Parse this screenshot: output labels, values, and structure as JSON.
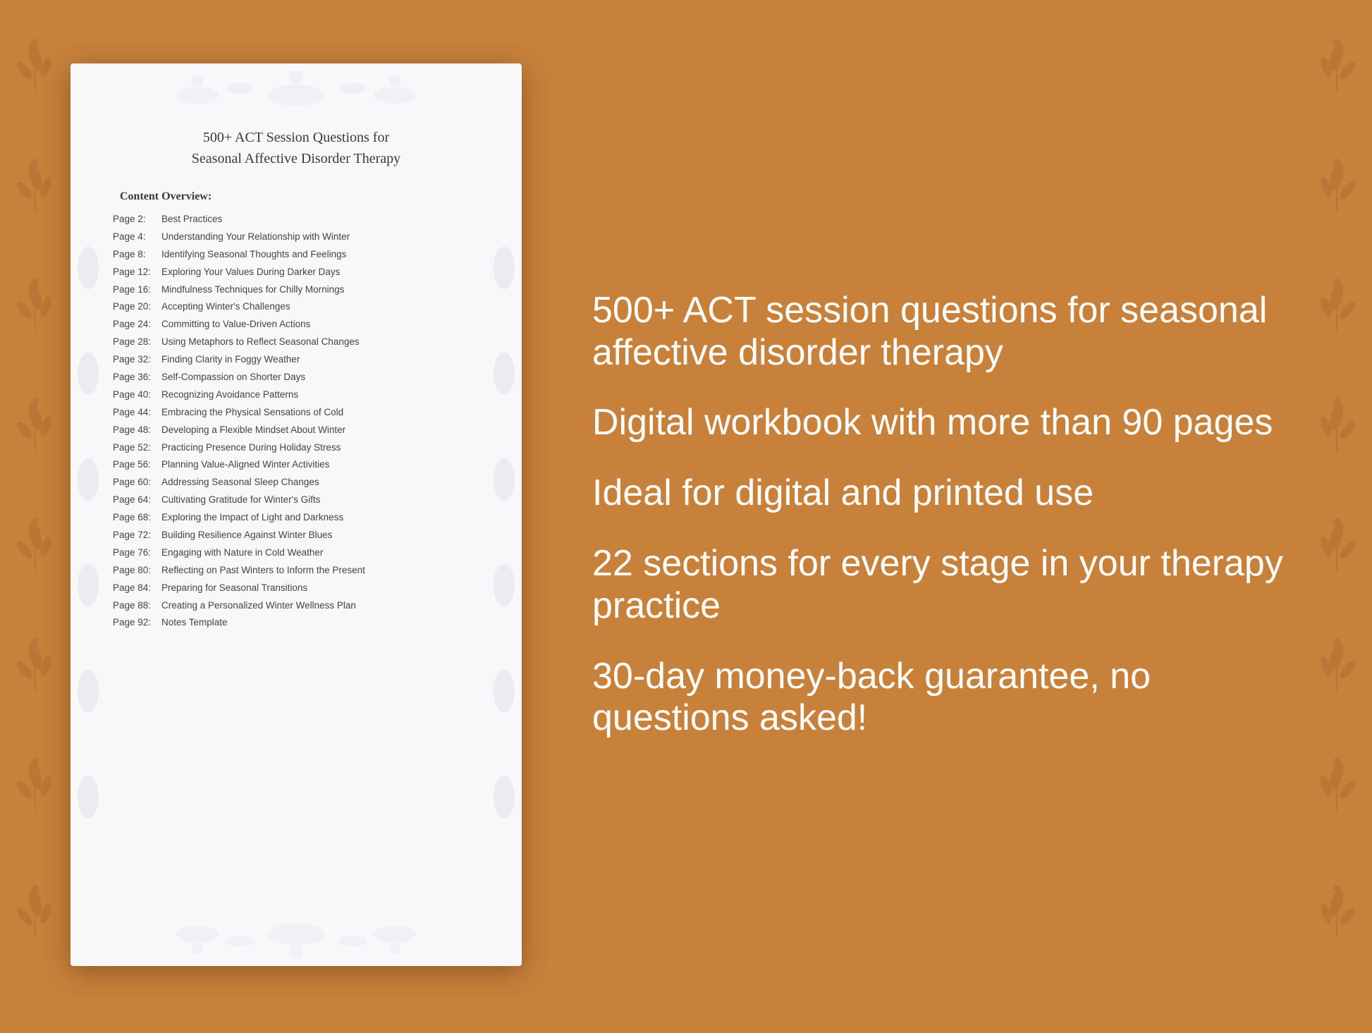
{
  "background_color": "#C8813A",
  "document": {
    "title_line1": "500+ ACT Session Questions for",
    "title_line2": "Seasonal Affective Disorder Therapy",
    "content_overview_label": "Content Overview:",
    "toc": [
      {
        "page": "Page  2:",
        "title": "Best Practices"
      },
      {
        "page": "Page  4:",
        "title": "Understanding Your Relationship with Winter"
      },
      {
        "page": "Page  8:",
        "title": "Identifying Seasonal Thoughts and Feelings"
      },
      {
        "page": "Page 12:",
        "title": "Exploring Your Values During Darker Days"
      },
      {
        "page": "Page 16:",
        "title": "Mindfulness Techniques for Chilly Mornings"
      },
      {
        "page": "Page 20:",
        "title": "Accepting Winter's Challenges"
      },
      {
        "page": "Page 24:",
        "title": "Committing to Value-Driven Actions"
      },
      {
        "page": "Page 28:",
        "title": "Using Metaphors to Reflect Seasonal Changes"
      },
      {
        "page": "Page 32:",
        "title": "Finding Clarity in Foggy Weather"
      },
      {
        "page": "Page 36:",
        "title": "Self-Compassion on Shorter Days"
      },
      {
        "page": "Page 40:",
        "title": "Recognizing Avoidance Patterns"
      },
      {
        "page": "Page 44:",
        "title": "Embracing the Physical Sensations of Cold"
      },
      {
        "page": "Page 48:",
        "title": "Developing a Flexible Mindset About Winter"
      },
      {
        "page": "Page 52:",
        "title": "Practicing Presence During Holiday Stress"
      },
      {
        "page": "Page 56:",
        "title": "Planning Value-Aligned Winter Activities"
      },
      {
        "page": "Page 60:",
        "title": "Addressing Seasonal Sleep Changes"
      },
      {
        "page": "Page 64:",
        "title": "Cultivating Gratitude for Winter's Gifts"
      },
      {
        "page": "Page 68:",
        "title": "Exploring the Impact of Light and Darkness"
      },
      {
        "page": "Page 72:",
        "title": "Building Resilience Against Winter Blues"
      },
      {
        "page": "Page 76:",
        "title": "Engaging with Nature in Cold Weather"
      },
      {
        "page": "Page 80:",
        "title": "Reflecting on Past Winters to Inform the Present"
      },
      {
        "page": "Page 84:",
        "title": "Preparing for Seasonal Transitions"
      },
      {
        "page": "Page 88:",
        "title": "Creating a Personalized Winter Wellness Plan"
      },
      {
        "page": "Page 92:",
        "title": "Notes Template"
      }
    ]
  },
  "features": [
    "500+ ACT session questions for seasonal affective disorder therapy",
    "Digital workbook with more than 90 pages",
    "Ideal for digital and printed use",
    "22 sections for every stage in your therapy practice",
    "30-day money-back guarantee, no questions asked!"
  ],
  "text_color_white": "#ffffff",
  "accent_color": "#bf7a35"
}
